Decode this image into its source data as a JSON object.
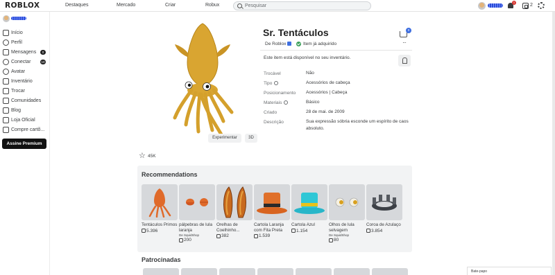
{
  "topbar": {
    "logo": "ROBLOX",
    "nav": [
      "Destaques",
      "Mercado",
      "Criar",
      "Robux"
    ],
    "search_placeholder": "Pesquisar",
    "notification_count": "1",
    "robux_balance": "2"
  },
  "sidebar": {
    "items": [
      {
        "label": "Início",
        "icon": "home-icon"
      },
      {
        "label": "Perfil",
        "icon": "profile-icon"
      },
      {
        "label": "Mensagens",
        "icon": "messages-icon",
        "badge": "0"
      },
      {
        "label": "Conectar",
        "icon": "connect-icon",
        "badge": "10"
      },
      {
        "label": "Avatar",
        "icon": "avatar-icon"
      },
      {
        "label": "Inventário",
        "icon": "inventory-icon"
      },
      {
        "label": "Trocar",
        "icon": "trade-icon"
      },
      {
        "label": "Comunidades",
        "icon": "communities-icon"
      },
      {
        "label": "Blog",
        "icon": "blog-icon"
      },
      {
        "label": "Loja Oficial",
        "icon": "store-icon"
      },
      {
        "label": "Compre cartõ...",
        "icon": "gift-card-icon"
      }
    ],
    "premium_button": "Assine Premium"
  },
  "item": {
    "title": "Sr. Tentáculos",
    "creator_prefix": "De ",
    "creator": "Roblox",
    "owned_label": "Item já adquirido",
    "cart_count": "0",
    "more": "···",
    "available_text": "Este item está disponível no seu inventário.",
    "try_button": "Experimentar",
    "btn_3d": "3D",
    "favorites": "45K",
    "details": [
      {
        "label": "Trocável",
        "value": "Não"
      },
      {
        "label": "Tipo",
        "value": "Acessórios de cabeça",
        "info": true
      },
      {
        "label": "Posicionamento",
        "value": "Acessórios | Cabeça"
      },
      {
        "label": "Materiais",
        "value": "Básico",
        "info": true
      },
      {
        "label": "Criado",
        "value": "28 de mai. de 2009"
      },
      {
        "label": "Descrição",
        "value": "Sua expressão sóbria esconde um espírito de caos absoluto."
      }
    ]
  },
  "recommendations": {
    "title": "Recommendations",
    "items": [
      {
        "name": "Tentáculos Primos",
        "creator": "",
        "price": "5.396"
      },
      {
        "name": "pálpebras de lula laranja",
        "creator": "De  SquidShop",
        "price": "200"
      },
      {
        "name": "Orelhas de Coelhinho...",
        "creator": "",
        "price": "382"
      },
      {
        "name": "Cartola Laranja com Fita Preta",
        "creator": "",
        "price": "1.539"
      },
      {
        "name": "Cartola Azul",
        "creator": "",
        "price": "1.154"
      },
      {
        "name": "Olhos de lula selvagem",
        "creator": "De  SquidShop",
        "price": "80"
      },
      {
        "name": "Coroa de Azulaço",
        "creator": "",
        "price": "3.854"
      }
    ]
  },
  "sponsored": {
    "title": "Patrocinadas"
  },
  "chat": {
    "label": "Bate-papo"
  }
}
